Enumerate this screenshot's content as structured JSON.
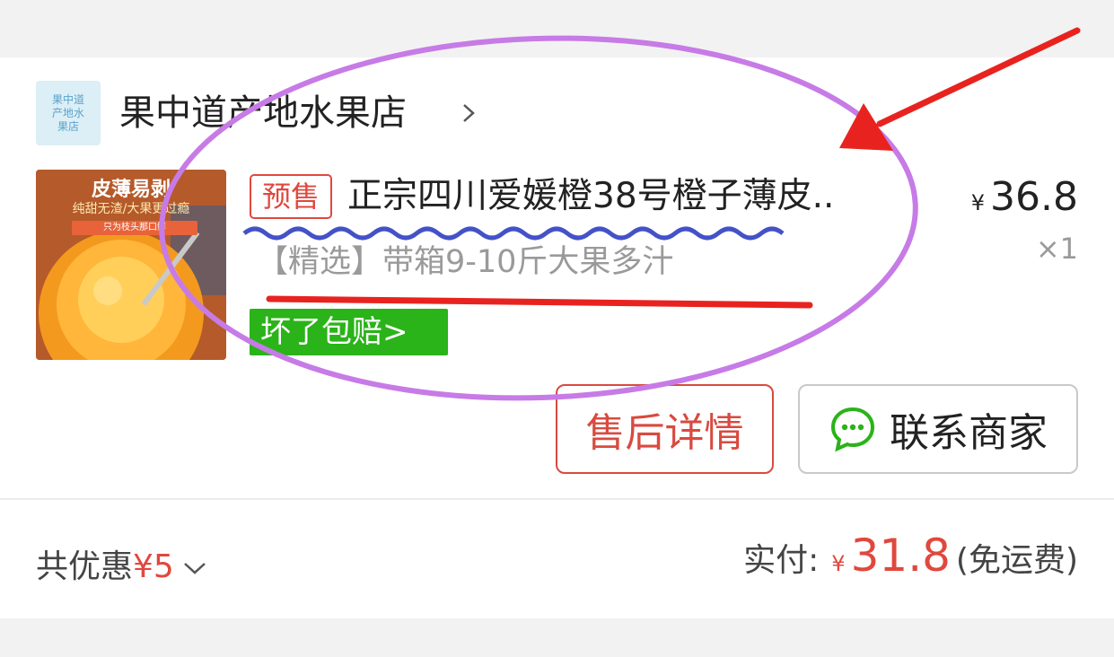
{
  "shop": {
    "logo_text": "果中道\n产地水\n果店",
    "name": "果中道产地水果店"
  },
  "product": {
    "thumbnail": {
      "headline": "皮薄易剥",
      "subline": "纯甜无渣/大果更过瘾",
      "band": "只为枝头那口鲜"
    },
    "presale_tag": "预售",
    "title": "正宗四川爱媛橙38号橙子薄皮..",
    "sku": "【精选】带箱9-10斤大果多汁",
    "guarantee_badge": "坏了包赔>",
    "price_currency": "¥",
    "price": "36.8",
    "quantity": "×1"
  },
  "actions": {
    "after_sales_label": "售后详情",
    "contact_label": "联系商家"
  },
  "summary": {
    "discount_label": "共优惠",
    "discount_amount": "¥5",
    "paid_label": "实付:",
    "paid_currency": "¥",
    "paid_amount": "31.8",
    "shipping_note": "(免运费)"
  },
  "colors": {
    "accent_red": "#e0483e",
    "guarantee_green": "#2bb31a",
    "annotation_purple": "#c77be6",
    "annotation_blue": "#4452c8",
    "annotation_red": "#e8231f"
  },
  "icons": {
    "shop_chevron": "chevron-right-icon",
    "contact": "chat-bubble-icon",
    "discount_toggle": "chevron-down-icon"
  }
}
